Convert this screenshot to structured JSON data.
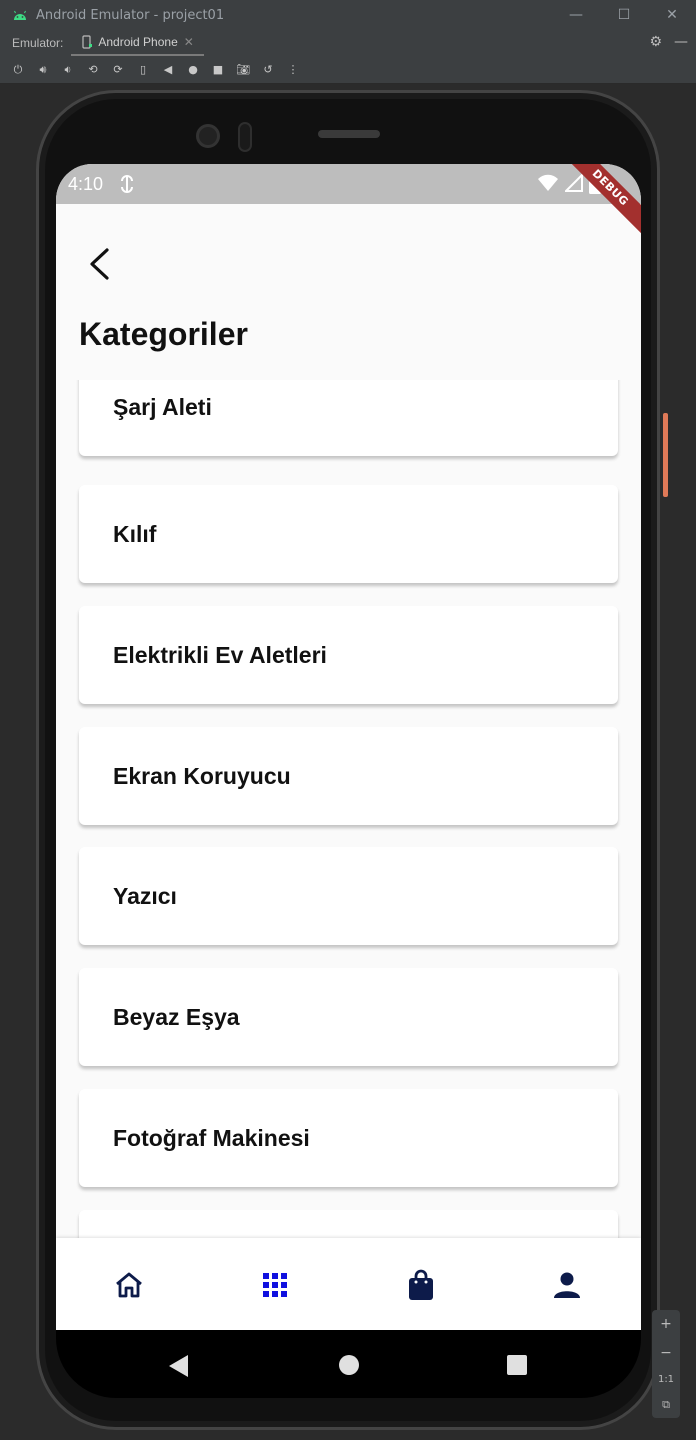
{
  "window": {
    "title": "Android Emulator - project01",
    "emulator_label": "Emulator:",
    "device_tab": "Android Phone"
  },
  "statusbar": {
    "time": "4:10",
    "debug_banner": "DEBUG"
  },
  "page": {
    "title": "Kategoriler"
  },
  "categories": [
    "Şarj Aleti",
    "Kılıf",
    "Elektrikli Ev Aletleri",
    "Ekran Koruyucu",
    "Yazıcı",
    "Beyaz Eşya",
    "Fotoğraf Makinesi"
  ],
  "bottom_nav": {
    "items": [
      {
        "icon": "home-icon"
      },
      {
        "icon": "grid-icon",
        "active": true
      },
      {
        "icon": "shopping-bag-icon"
      },
      {
        "icon": "person-icon"
      }
    ],
    "active_color": "#1010e0",
    "inactive_color": "#0d1b4a"
  },
  "zoom": {
    "plus": "+",
    "minus": "−",
    "ratio": "1:1"
  }
}
